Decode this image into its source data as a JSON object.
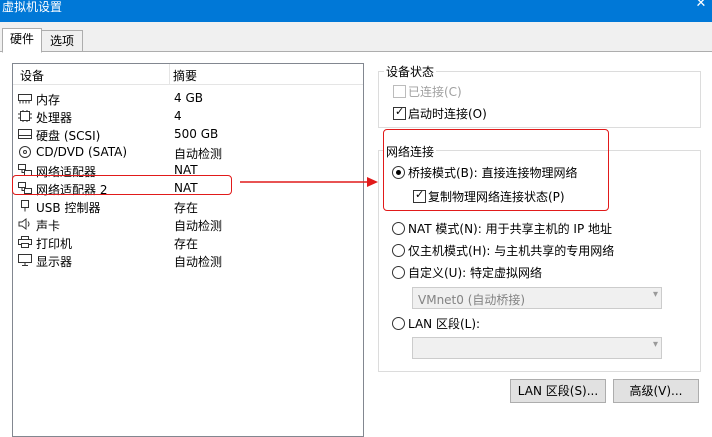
{
  "window": {
    "title": "虚拟机设置",
    "close_glyph": "✕"
  },
  "tabs": [
    {
      "label": "硬件"
    },
    {
      "label": "选项"
    }
  ],
  "device_list": {
    "col_device": "设备",
    "col_summary": "摘要",
    "rows": [
      {
        "name": "内存",
        "summary": "4 GB",
        "icon": "memory-icon"
      },
      {
        "name": "处理器",
        "summary": "4",
        "icon": "processor-icon"
      },
      {
        "name": "硬盘 (SCSI)",
        "summary": "500 GB",
        "icon": "hard-disk-icon"
      },
      {
        "name": "CD/DVD (SATA)",
        "summary": "自动检测",
        "icon": "cd-dvd-icon"
      },
      {
        "name": "网络适配器",
        "summary": "NAT",
        "icon": "network-adapter-icon"
      },
      {
        "name": "网络适配器 2",
        "summary": "NAT",
        "icon": "network-adapter-icon"
      },
      {
        "name": "USB 控制器",
        "summary": "存在",
        "icon": "usb-icon"
      },
      {
        "name": "声卡",
        "summary": "自动检测",
        "icon": "speaker-icon"
      },
      {
        "name": "打印机",
        "summary": "存在",
        "icon": "printer-icon"
      },
      {
        "name": "显示器",
        "summary": "自动检测",
        "icon": "monitor-icon"
      }
    ]
  },
  "device_status": {
    "title": "设备状态",
    "connected": {
      "label": "已连接(C)",
      "checked": false,
      "disabled": true
    },
    "connect_at_power_on": {
      "label": "启动时连接(O)",
      "checked": true
    }
  },
  "network_connection": {
    "title": "网络连接",
    "bridged": {
      "label": "桥接模式(B): 直接连接物理网络",
      "selected": true
    },
    "replicate": {
      "label": "复制物理网络连接状态(P)",
      "checked": true
    },
    "nat": {
      "label": "NAT 模式(N): 用于共享主机的 IP 地址",
      "selected": false
    },
    "host_only": {
      "label": "仅主机模式(H): 与主机共享的专用网络",
      "selected": false
    },
    "custom": {
      "label": "自定义(U): 特定虚拟网络",
      "selected": false
    },
    "custom_select": {
      "value": "VMnet0 (自动桥接)"
    },
    "lan_segment": {
      "label": "LAN 区段(L):",
      "selected": false
    },
    "lan_select": {
      "value": ""
    }
  },
  "buttons": {
    "lan_segments": "LAN 区段(S)...",
    "advanced": "高级(V)..."
  },
  "colors": {
    "titlebar": "#0078d7",
    "annotation": "#e11a1a"
  },
  "check_glyph": "✓",
  "arrow_glyph": "▾"
}
